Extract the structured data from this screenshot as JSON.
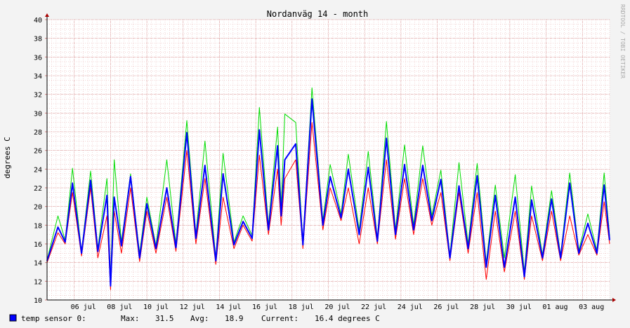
{
  "chart_data": {
    "type": "line",
    "title": "Nordanväg 14 - month",
    "ylabel": "degrees C",
    "xlabel": "",
    "ylim": [
      10,
      40
    ],
    "y_ticks": [
      10,
      12,
      14,
      16,
      18,
      20,
      22,
      24,
      26,
      28,
      30,
      32,
      34,
      36,
      38,
      40
    ],
    "x_ticks": [
      "06 jul",
      "08 jul",
      "10 jul",
      "12 jul",
      "14 jul",
      "16 jul",
      "18 jul",
      "20 jul",
      "22 jul",
      "24 jul",
      "26 jul",
      "28 jul",
      "30 jul",
      "01 aug",
      "03 aug"
    ],
    "x_range_days": [
      4.5,
      35.5
    ],
    "grid": true,
    "legend_position": "bottom",
    "watermark": "RRDTOOL / TOBI OETIKER",
    "colors": {
      "avg": "#0000ff",
      "min": "#ff0000",
      "max": "#00dd00",
      "grid_minor": "#e6aaaa",
      "arrow": "#aa0000",
      "background": "#f3f3f3",
      "canvas": "#ffffff"
    },
    "daily_peaks": [
      {
        "day": 5.1,
        "avg": 17.8,
        "min": 17.2,
        "max": 19.0
      },
      {
        "day": 5.9,
        "avg": 22.5,
        "min": 21.5,
        "max": 24.1
      },
      {
        "day": 6.9,
        "avg": 22.8,
        "min": 22.0,
        "max": 23.8
      },
      {
        "day": 7.8,
        "avg": 21.2,
        "min": 19.0,
        "max": 23.0
      },
      {
        "day": 8.2,
        "avg": 21.0,
        "min": 19.5,
        "max": 25.0
      },
      {
        "day": 9.1,
        "avg": 23.2,
        "min": 22.0,
        "max": 23.5
      },
      {
        "day": 10.0,
        "avg": 20.3,
        "min": 19.5,
        "max": 21.0
      },
      {
        "day": 11.1,
        "avg": 22.0,
        "min": 21.0,
        "max": 25.0
      },
      {
        "day": 12.2,
        "avg": 27.9,
        "min": 26.0,
        "max": 29.2
      },
      {
        "day": 13.2,
        "avg": 24.4,
        "min": 23.0,
        "max": 27.0
      },
      {
        "day": 14.2,
        "avg": 23.5,
        "min": 21.0,
        "max": 25.7
      },
      {
        "day": 15.3,
        "avg": 18.4,
        "min": 18.0,
        "max": 19.0
      },
      {
        "day": 16.2,
        "avg": 28.2,
        "min": 25.5,
        "max": 30.6
      },
      {
        "day": 17.2,
        "avg": 26.5,
        "min": 24.0,
        "max": 28.5
      },
      {
        "day": 17.6,
        "avg": 25.0,
        "min": 23.0,
        "max": 29.9
      },
      {
        "day": 18.2,
        "avg": 26.7,
        "min": 25.0,
        "max": 29.0
      },
      {
        "day": 19.1,
        "avg": 31.5,
        "min": 29.0,
        "max": 32.7
      },
      {
        "day": 20.1,
        "avg": 23.2,
        "min": 22.0,
        "max": 24.5
      },
      {
        "day": 21.1,
        "avg": 24.0,
        "min": 22.0,
        "max": 25.6
      },
      {
        "day": 22.2,
        "avg": 24.2,
        "min": 22.0,
        "max": 25.9
      },
      {
        "day": 23.2,
        "avg": 27.3,
        "min": 25.0,
        "max": 29.1
      },
      {
        "day": 24.2,
        "avg": 24.5,
        "min": 23.0,
        "max": 26.6
      },
      {
        "day": 25.2,
        "avg": 24.4,
        "min": 23.0,
        "max": 26.5
      },
      {
        "day": 26.2,
        "avg": 22.9,
        "min": 21.5,
        "max": 23.9
      },
      {
        "day": 27.2,
        "avg": 22.2,
        "min": 21.5,
        "max": 24.7
      },
      {
        "day": 28.2,
        "avg": 23.3,
        "min": 21.5,
        "max": 24.6
      },
      {
        "day": 29.2,
        "avg": 21.2,
        "min": 19.5,
        "max": 22.3
      },
      {
        "day": 30.3,
        "avg": 21.0,
        "min": 19.5,
        "max": 23.4
      },
      {
        "day": 31.2,
        "avg": 20.7,
        "min": 19.0,
        "max": 22.2
      },
      {
        "day": 32.3,
        "avg": 20.8,
        "min": 19.5,
        "max": 21.7
      },
      {
        "day": 33.3,
        "avg": 22.5,
        "min": 19.0,
        "max": 23.6
      },
      {
        "day": 34.3,
        "avg": 18.2,
        "min": 17.0,
        "max": 19.2
      },
      {
        "day": 35.2,
        "avg": 22.3,
        "min": 20.5,
        "max": 23.6
      }
    ],
    "daily_troughs": [
      {
        "day": 4.5,
        "avg": 14.2,
        "min": 14.0,
        "max": 14.3
      },
      {
        "day": 5.5,
        "avg": 16.2,
        "min": 16.0,
        "max": 16.4
      },
      {
        "day": 6.4,
        "avg": 15.0,
        "min": 14.7,
        "max": 15.2
      },
      {
        "day": 7.3,
        "avg": 15.2,
        "min": 14.5,
        "max": 15.5
      },
      {
        "day": 8.0,
        "avg": 11.5,
        "min": 11.1,
        "max": 12.0
      },
      {
        "day": 8.6,
        "avg": 15.8,
        "min": 15.0,
        "max": 16.2
      },
      {
        "day": 9.6,
        "avg": 14.5,
        "min": 14.1,
        "max": 15.0
      },
      {
        "day": 10.5,
        "avg": 15.5,
        "min": 15.0,
        "max": 15.8
      },
      {
        "day": 11.6,
        "avg": 15.6,
        "min": 15.2,
        "max": 16.0
      },
      {
        "day": 12.7,
        "avg": 16.6,
        "min": 16.0,
        "max": 17.0
      },
      {
        "day": 13.8,
        "avg": 14.2,
        "min": 13.8,
        "max": 14.5
      },
      {
        "day": 14.8,
        "avg": 15.9,
        "min": 15.5,
        "max": 16.2
      },
      {
        "day": 15.8,
        "avg": 16.6,
        "min": 16.3,
        "max": 16.9
      },
      {
        "day": 16.7,
        "avg": 17.5,
        "min": 17.0,
        "max": 18.0
      },
      {
        "day": 17.4,
        "avg": 19.0,
        "min": 18.0,
        "max": 20.0
      },
      {
        "day": 18.6,
        "avg": 15.9,
        "min": 15.5,
        "max": 16.2
      },
      {
        "day": 19.7,
        "avg": 18.0,
        "min": 17.5,
        "max": 18.5
      },
      {
        "day": 20.7,
        "avg": 18.8,
        "min": 18.5,
        "max": 19.2
      },
      {
        "day": 21.7,
        "avg": 17.0,
        "min": 16.0,
        "max": 17.5
      },
      {
        "day": 22.7,
        "avg": 16.3,
        "min": 16.0,
        "max": 16.6
      },
      {
        "day": 23.7,
        "avg": 17.0,
        "min": 16.5,
        "max": 17.5
      },
      {
        "day": 24.7,
        "avg": 17.5,
        "min": 17.0,
        "max": 18.0
      },
      {
        "day": 25.7,
        "avg": 18.5,
        "min": 18.0,
        "max": 19.0
      },
      {
        "day": 26.7,
        "avg": 14.5,
        "min": 14.2,
        "max": 14.8
      },
      {
        "day": 27.7,
        "avg": 15.5,
        "min": 15.0,
        "max": 16.0
      },
      {
        "day": 28.7,
        "avg": 13.5,
        "min": 12.2,
        "max": 14.0
      },
      {
        "day": 29.7,
        "avg": 13.5,
        "min": 13.0,
        "max": 14.5
      },
      {
        "day": 30.8,
        "avg": 12.5,
        "min": 12.2,
        "max": 13.0
      },
      {
        "day": 31.8,
        "avg": 14.5,
        "min": 14.2,
        "max": 14.8
      },
      {
        "day": 32.8,
        "avg": 14.5,
        "min": 14.2,
        "max": 14.8
      },
      {
        "day": 33.8,
        "avg": 15.0,
        "min": 14.8,
        "max": 15.3
      },
      {
        "day": 34.8,
        "avg": 15.0,
        "min": 14.8,
        "max": 15.3
      },
      {
        "day": 35.5,
        "avg": 16.4,
        "min": 16.0,
        "max": 16.8
      }
    ]
  },
  "legend": {
    "label": "temp sensor 0:",
    "max_label": "Max:",
    "max_value": "31.5",
    "avg_label": "Avg:",
    "avg_value": "18.9",
    "current_label": "Current:",
    "current_value": "16.4 degrees C"
  }
}
